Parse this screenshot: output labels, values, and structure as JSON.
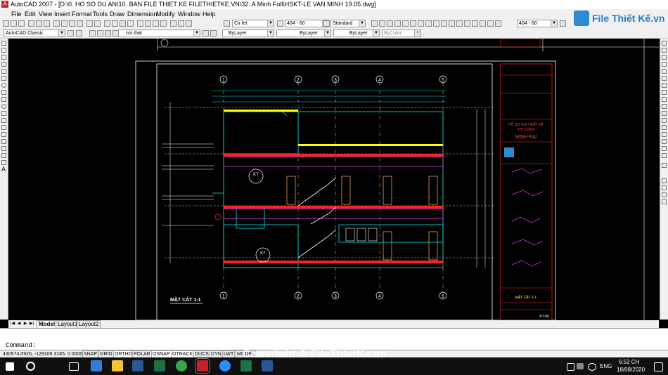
{
  "window": {
    "title": "AutoCAD 2007 - [D:\\0. HO SO DU AN\\10. BAN FILE THIET KE FILETHIETKE.VN\\32. A Minh Full\\HSKT-LE VAN MINH 19.05.dwg]",
    "app_icon": "A"
  },
  "menu": [
    "File",
    "Edit",
    "View",
    "Insert",
    "Format",
    "Tools",
    "Draw",
    "Dimension",
    "Modify",
    "Window",
    "Help"
  ],
  "toolbar": {
    "text_style": "Cir let",
    "dim_style": "404 - 60",
    "table_style": "Standard",
    "right_style": "404 - 60",
    "workspace": "AutoCAD Classic",
    "layer": "noi that",
    "color": "ByLayer",
    "linetype": "ByLayer",
    "lineweight": "ByLayer",
    "plotstyle": "ByColor"
  },
  "logo": {
    "text": "File Thiết Kế.vn"
  },
  "drawing": {
    "section_title": "MẶT CẮT 1-1",
    "grid_labels": [
      "1",
      "2",
      "3",
      "4",
      "5"
    ],
    "tag1": "KT",
    "tag2": "KT",
    "titleblock": {
      "t1": "HỒ SƠ XIN THIẾT KẾ",
      "t2": "THI CÔNG",
      "company": "MINH ĐẠI",
      "sheet": "MẶT CẮT 1-1",
      "sheet_no": "KT-06"
    }
  },
  "tabs": {
    "model": "Model",
    "layout1": "Layout1",
    "layout2": "Layout2"
  },
  "command": {
    "prompt": "Command:"
  },
  "status": {
    "coords": "430974.0920, -129106.3185, 0.0000",
    "buttons": [
      "SNAP",
      "GRID",
      "ORTHO",
      "POLAR",
      "OSNAP",
      "OTRACK",
      "DUCS",
      "DYN",
      "LWT",
      "MODEL"
    ]
  },
  "watermark": "Copyright © FileThietKe.vn",
  "taskbar": {
    "lang": "ENG",
    "time": "6:52 CH",
    "date": "18/08/2020"
  },
  "colors": {
    "cad_bg": "#000000",
    "cyan": "#00e5e5",
    "yellow": "#ffff00",
    "red": "#ff2020",
    "magenta": "#e040e0"
  }
}
